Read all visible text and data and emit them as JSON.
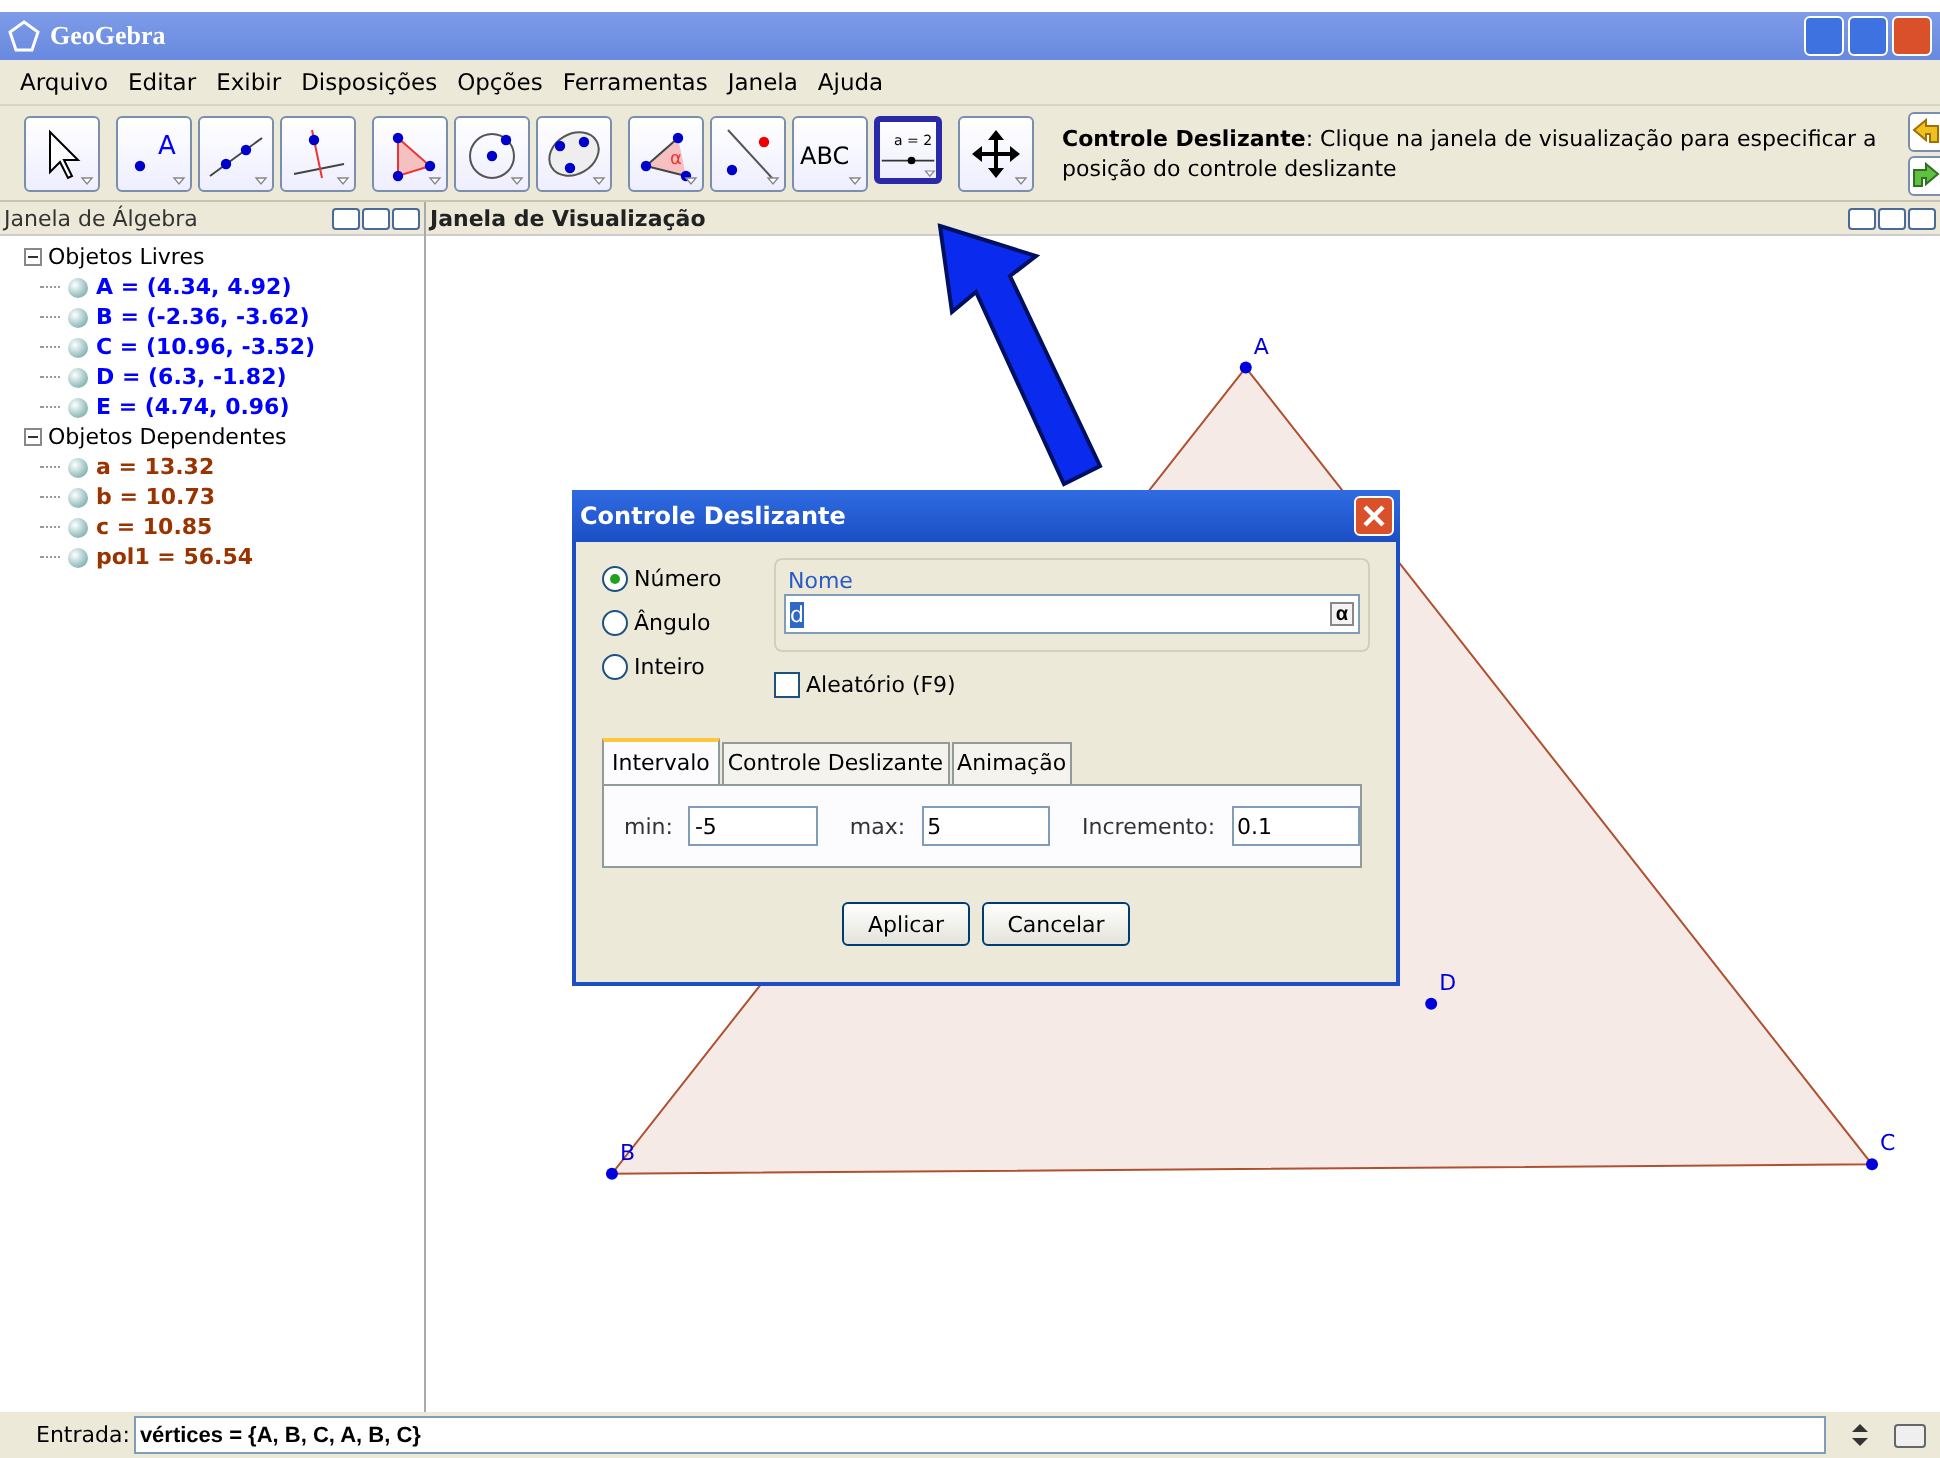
{
  "window": {
    "title": "GeoGebra"
  },
  "menu": [
    "Arquivo",
    "Editar",
    "Exibir",
    "Disposições",
    "Opções",
    "Ferramentas",
    "Janela",
    "Ajuda"
  ],
  "toolbar": {
    "groups": [
      [
        {
          "kind": "move",
          "selected": false
        }
      ],
      [
        {
          "kind": "point",
          "selected": false,
          "text": "A"
        },
        {
          "kind": "line",
          "selected": false
        },
        {
          "kind": "perpendicular",
          "selected": false
        }
      ],
      [
        {
          "kind": "polygon",
          "selected": false
        },
        {
          "kind": "circle",
          "selected": false
        },
        {
          "kind": "conic",
          "selected": false
        }
      ],
      [
        {
          "kind": "angle",
          "selected": false,
          "text": "α"
        },
        {
          "kind": "reflect",
          "selected": false
        },
        {
          "kind": "text",
          "selected": false,
          "text": "ABC"
        },
        {
          "kind": "slider",
          "selected": true,
          "text": "a = 2"
        }
      ],
      [
        {
          "kind": "pan",
          "selected": false
        }
      ]
    ],
    "help": "**Controle Deslizante**: Clique na janela de visualização para especificar a posição do controle deslizante"
  },
  "algebra": {
    "title": "Janela de Álgebra",
    "groups": [
      {
        "label": "Objetos Livres",
        "expanded": true,
        "children": [
          {
            "text": "A = (4.34, 4.92)",
            "color": "#0000ff"
          },
          {
            "text": "B = (-2.36, -3.62)",
            "color": "#0000ff"
          },
          {
            "text": "C = (10.96, -3.52)",
            "color": "#0000ff"
          },
          {
            "text": "D = (6.3, -1.82)",
            "color": "#0000ff"
          },
          {
            "text": "E = (4.74, 0.96)",
            "color": "#0000ff"
          }
        ]
      },
      {
        "label": "Objetos Dependentes",
        "expanded": true,
        "children": [
          {
            "text": "a = 13.32",
            "color": "#993300"
          },
          {
            "text": "b = 10.73",
            "color": "#993300"
          },
          {
            "text": "c = 10.85",
            "color": "#993300"
          },
          {
            "text": "pol1 = 56.54",
            "color": "#993300"
          }
        ]
      }
    ]
  },
  "graphics": {
    "title": "Janela de Visualização",
    "points": [
      {
        "label": "A"
      },
      {
        "label": "B"
      },
      {
        "label": "C"
      },
      {
        "label": "D"
      }
    ]
  },
  "dialog": {
    "title": "Controle Deslizante",
    "types": [
      {
        "label": "Número",
        "selected": true
      },
      {
        "label": "Ângulo",
        "selected": false
      },
      {
        "label": "Inteiro",
        "selected": false
      }
    ],
    "name_legend": "Nome",
    "name_value": "d",
    "alpha_button": "α",
    "random": {
      "label": "Aleatório (F9)",
      "checked": false
    },
    "tabs": [
      {
        "label": "Intervalo",
        "selected": true
      },
      {
        "label": "Controle Deslizante",
        "selected": false
      },
      {
        "label": "Animação",
        "selected": false
      }
    ],
    "fields": [
      {
        "label": "min:",
        "value": "-5"
      },
      {
        "label": "max:",
        "value": "5"
      },
      {
        "label": "Incremento:",
        "value": "0.1"
      }
    ],
    "buttons": [
      "Aplicar",
      "Cancelar"
    ]
  },
  "input": {
    "label": "Entrada:",
    "value": "vértices = {A, B, C, A, B, C}"
  }
}
